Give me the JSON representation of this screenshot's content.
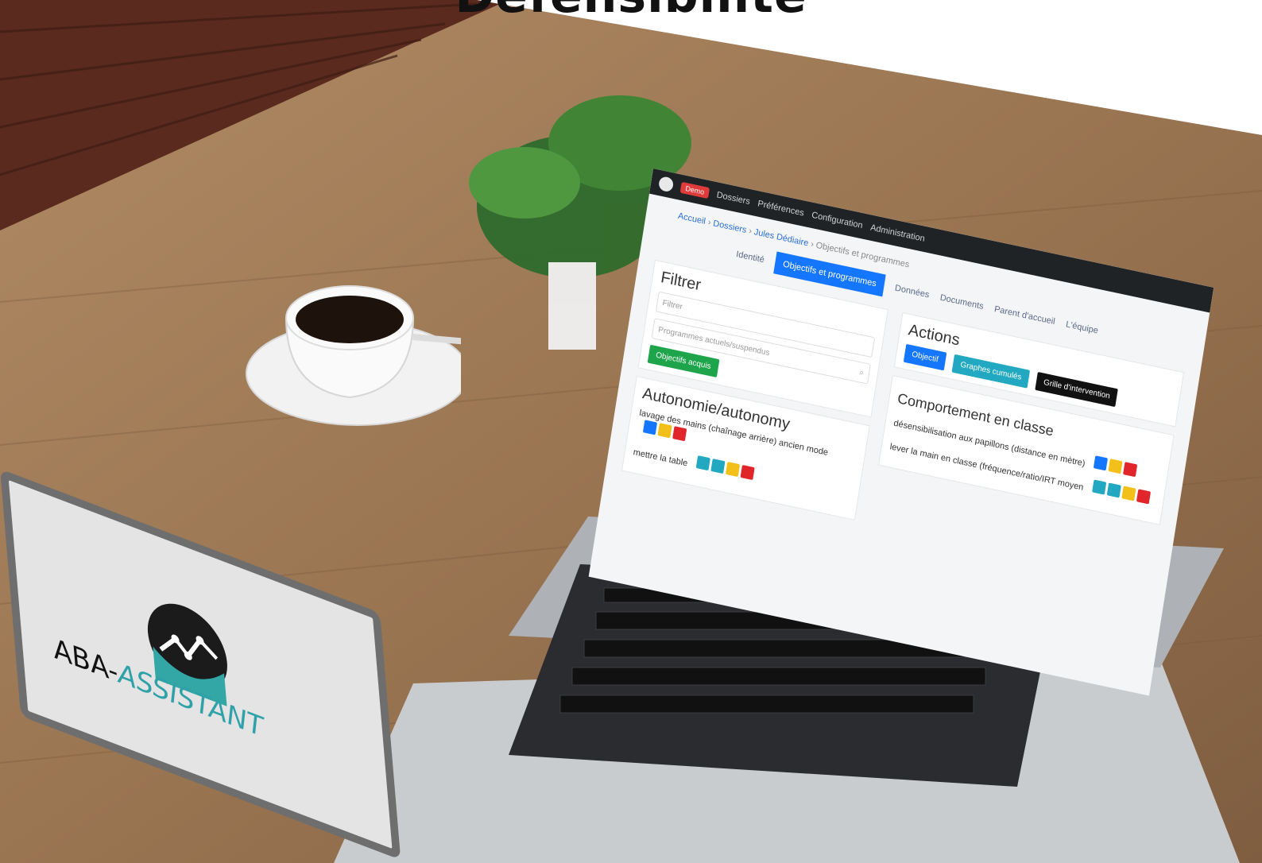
{
  "heading": "Défensibilité",
  "brand": {
    "name_part1": "ABA-",
    "name_part2": "ASSISTANT"
  },
  "screen": {
    "topbar": {
      "badge": "Demo",
      "nav": [
        "Dossiers",
        "Préférences",
        "Configuration",
        "Administration"
      ]
    },
    "breadcrumb": [
      "Accueil",
      "Dossiers",
      "Jules Dédiaire",
      "Objectifs et programmes"
    ],
    "tabs": {
      "items": [
        "Identité",
        "Objectifs et programmes",
        "Données",
        "Documents",
        "Parent d'accueil",
        "L'équipe"
      ],
      "active_index": 1
    },
    "filter": {
      "title": "Filtrer",
      "filter_placeholder": "Filtrer",
      "search_placeholder": "Programmes actuels/suspendus",
      "acquired_button": "Objectifs acquis"
    },
    "actions": {
      "title": "Actions",
      "buttons": [
        "Objectif",
        "Graphes cumulés",
        "Grille d'intervention"
      ]
    },
    "sections": [
      {
        "title": "Autonomie/autonomy",
        "items": [
          "lavage des mains (chaînage arrière) ancien mode",
          "mettre la table"
        ]
      },
      {
        "title": "Comportement en classe",
        "items": [
          "désensibilisation aux papillons (distance en mètre)",
          "lever la main en classe (fréquence/ratio/IRT moyen"
        ]
      }
    ]
  }
}
